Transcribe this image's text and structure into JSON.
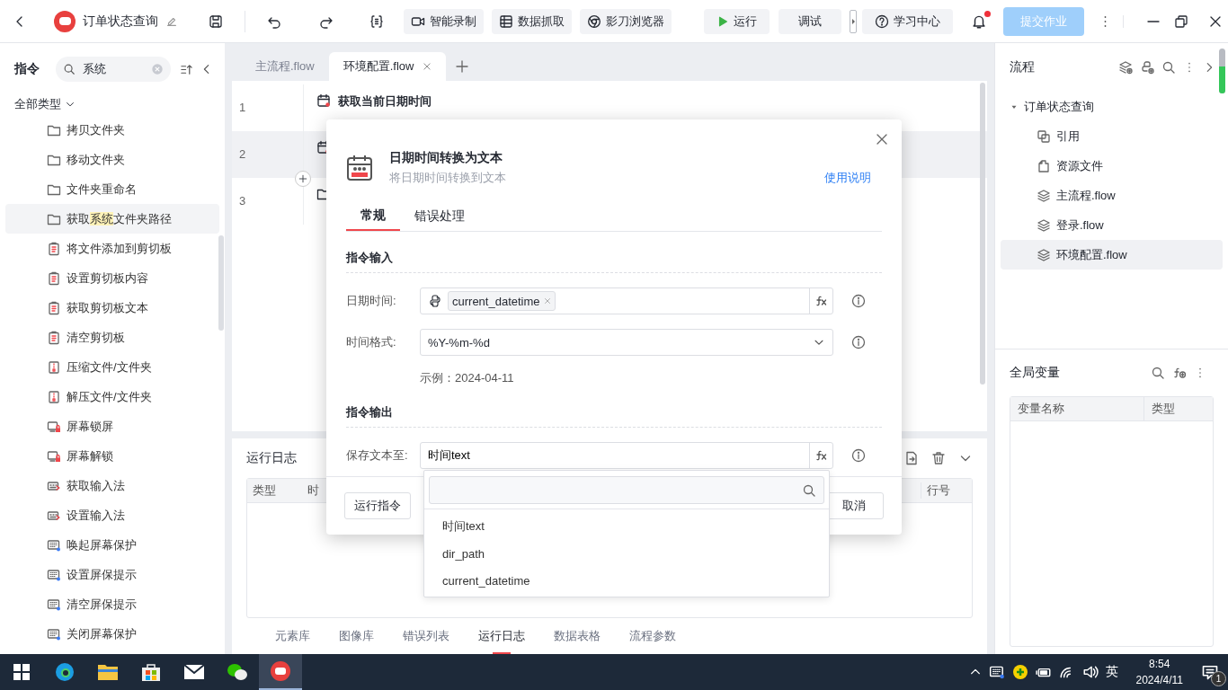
{
  "topbar": {
    "title": "订单状态查询",
    "toolbar_buttons": [
      {
        "label": "智能录制",
        "kind": "record"
      },
      {
        "label": "数据抓取",
        "kind": "table"
      },
      {
        "label": "影刀浏览器",
        "kind": "browser"
      }
    ],
    "run_button": "运行",
    "debug_button": "调试",
    "help_button": "学习中心",
    "notifications_unread": true,
    "submit_button": {
      "label": "提交作业",
      "disabled": true
    }
  },
  "sidebar": {
    "title": "指令",
    "search": {
      "value": "系统"
    },
    "filter": "全部类型",
    "items": [
      {
        "label": "拷贝文件夹",
        "kind": "folder",
        "selected": false
      },
      {
        "label": "移动文件夹",
        "kind": "folder",
        "selected": false
      },
      {
        "label": "文件夹重命名",
        "kind": "folder",
        "selected": false
      },
      {
        "segments": [
          {
            "text": "获取",
            "match": false
          },
          {
            "text": "系统",
            "match": true
          },
          {
            "text": "文件夹路径",
            "match": false
          }
        ],
        "kind": "folder",
        "selected": true
      },
      {
        "label": "将文件添加到剪切板",
        "kind": "clipboard",
        "selected": false
      },
      {
        "label": "设置剪切板内容",
        "kind": "clipboard",
        "selected": false
      },
      {
        "label": "获取剪切板文本",
        "kind": "clipboard",
        "selected": false
      },
      {
        "label": "清空剪切板",
        "kind": "clipboard",
        "selected": false
      },
      {
        "label": "压缩文件/文件夹",
        "kind": "archive",
        "selected": false
      },
      {
        "label": "解压文件/文件夹",
        "kind": "archive",
        "selected": false
      },
      {
        "label": "屏幕锁屏",
        "kind": "lock",
        "selected": false
      },
      {
        "label": "屏幕解锁",
        "kind": "lock",
        "selected": false
      },
      {
        "label": "获取输入法",
        "kind": "keyboard",
        "selected": false
      },
      {
        "label": "设置输入法",
        "kind": "keyboard",
        "selected": false
      },
      {
        "label": "唤起屏幕保护",
        "kind": "screen",
        "selected": false
      },
      {
        "label": "设置屏保提示",
        "kind": "screen",
        "selected": false
      },
      {
        "label": "清空屏保提示",
        "kind": "screen",
        "selected": false
      },
      {
        "label": "关闭屏幕保护",
        "kind": "screen",
        "selected": false
      }
    ]
  },
  "editor": {
    "tabs": [
      {
        "label": "主流程.flow",
        "selected": false
      },
      {
        "label": "环境配置.flow",
        "selected": true
      }
    ],
    "lines": [
      {
        "number": "1",
        "title": "获取当前日期时间",
        "kind": "calendar",
        "selected": false
      },
      {
        "number": "2",
        "kind": "calendar",
        "selected": true
      },
      {
        "number": "3",
        "kind": "folder",
        "selected": false
      }
    ]
  },
  "log_panel": {
    "title": "运行日志",
    "columns": [
      "类型",
      "时",
      "行号"
    ],
    "tabs": [
      {
        "label": "元素库",
        "selected": false
      },
      {
        "label": "图像库",
        "selected": false
      },
      {
        "label": "错误列表",
        "selected": false
      },
      {
        "label": "运行日志",
        "selected": true
      },
      {
        "label": "数据表格",
        "selected": false
      },
      {
        "label": "流程参数",
        "selected": false
      }
    ]
  },
  "dialog": {
    "title": "日期时间转换为文本",
    "subtitle": "将日期时间转换到文本",
    "help_link": "使用说明",
    "tabs": [
      {
        "label": "常规",
        "selected": true
      },
      {
        "label": "错误处理",
        "selected": false
      }
    ],
    "sections": [
      {
        "title": "指令输入",
        "fields": [
          {
            "kind": "variable",
            "label": "日期时间:",
            "chips": [
              "current_datetime"
            ]
          },
          {
            "kind": "select",
            "label": "时间格式:",
            "value": "%Y-%m-%d",
            "example": "示例：2024-04-11"
          }
        ]
      },
      {
        "title": "指令输出",
        "fields": [
          {
            "kind": "text",
            "label": "保存文本至:",
            "value": "时间text",
            "expanded": true,
            "options": [
              "时间text",
              "dir_path",
              "current_datetime"
            ]
          }
        ]
      }
    ],
    "buttons": [
      {
        "label": "运行指令",
        "kind": "left"
      },
      {
        "label": "取消",
        "kind": "right"
      }
    ]
  },
  "flow_panel": {
    "title": "流程",
    "tree": [
      {
        "label": "订单状态查询",
        "expanded": true,
        "selected": false,
        "children": [
          {
            "label": "引用",
            "kind": "reference",
            "selected": false
          },
          {
            "label": "资源文件",
            "kind": "resource",
            "selected": false
          },
          {
            "label": "主流程.flow",
            "kind": "flow",
            "selected": false
          },
          {
            "label": "登录.flow",
            "kind": "flow",
            "selected": false
          },
          {
            "label": "环境配置.flow",
            "kind": "flow",
            "selected": true
          }
        ]
      }
    ]
  },
  "variables_panel": {
    "title": "全局变量",
    "columns": [
      "变量名称",
      "类型"
    ]
  },
  "taskbar": {
    "apps": [
      {
        "kind": "edge",
        "active": false
      },
      {
        "kind": "explorer",
        "active": false
      },
      {
        "kind": "store",
        "active": false
      },
      {
        "kind": "mail",
        "active": false
      },
      {
        "kind": "wechat",
        "active": false
      },
      {
        "kind": "rpa",
        "active": true
      }
    ],
    "input_method": "英",
    "time": "8:54",
    "date": "2024/4/11",
    "notification_count": "1"
  }
}
